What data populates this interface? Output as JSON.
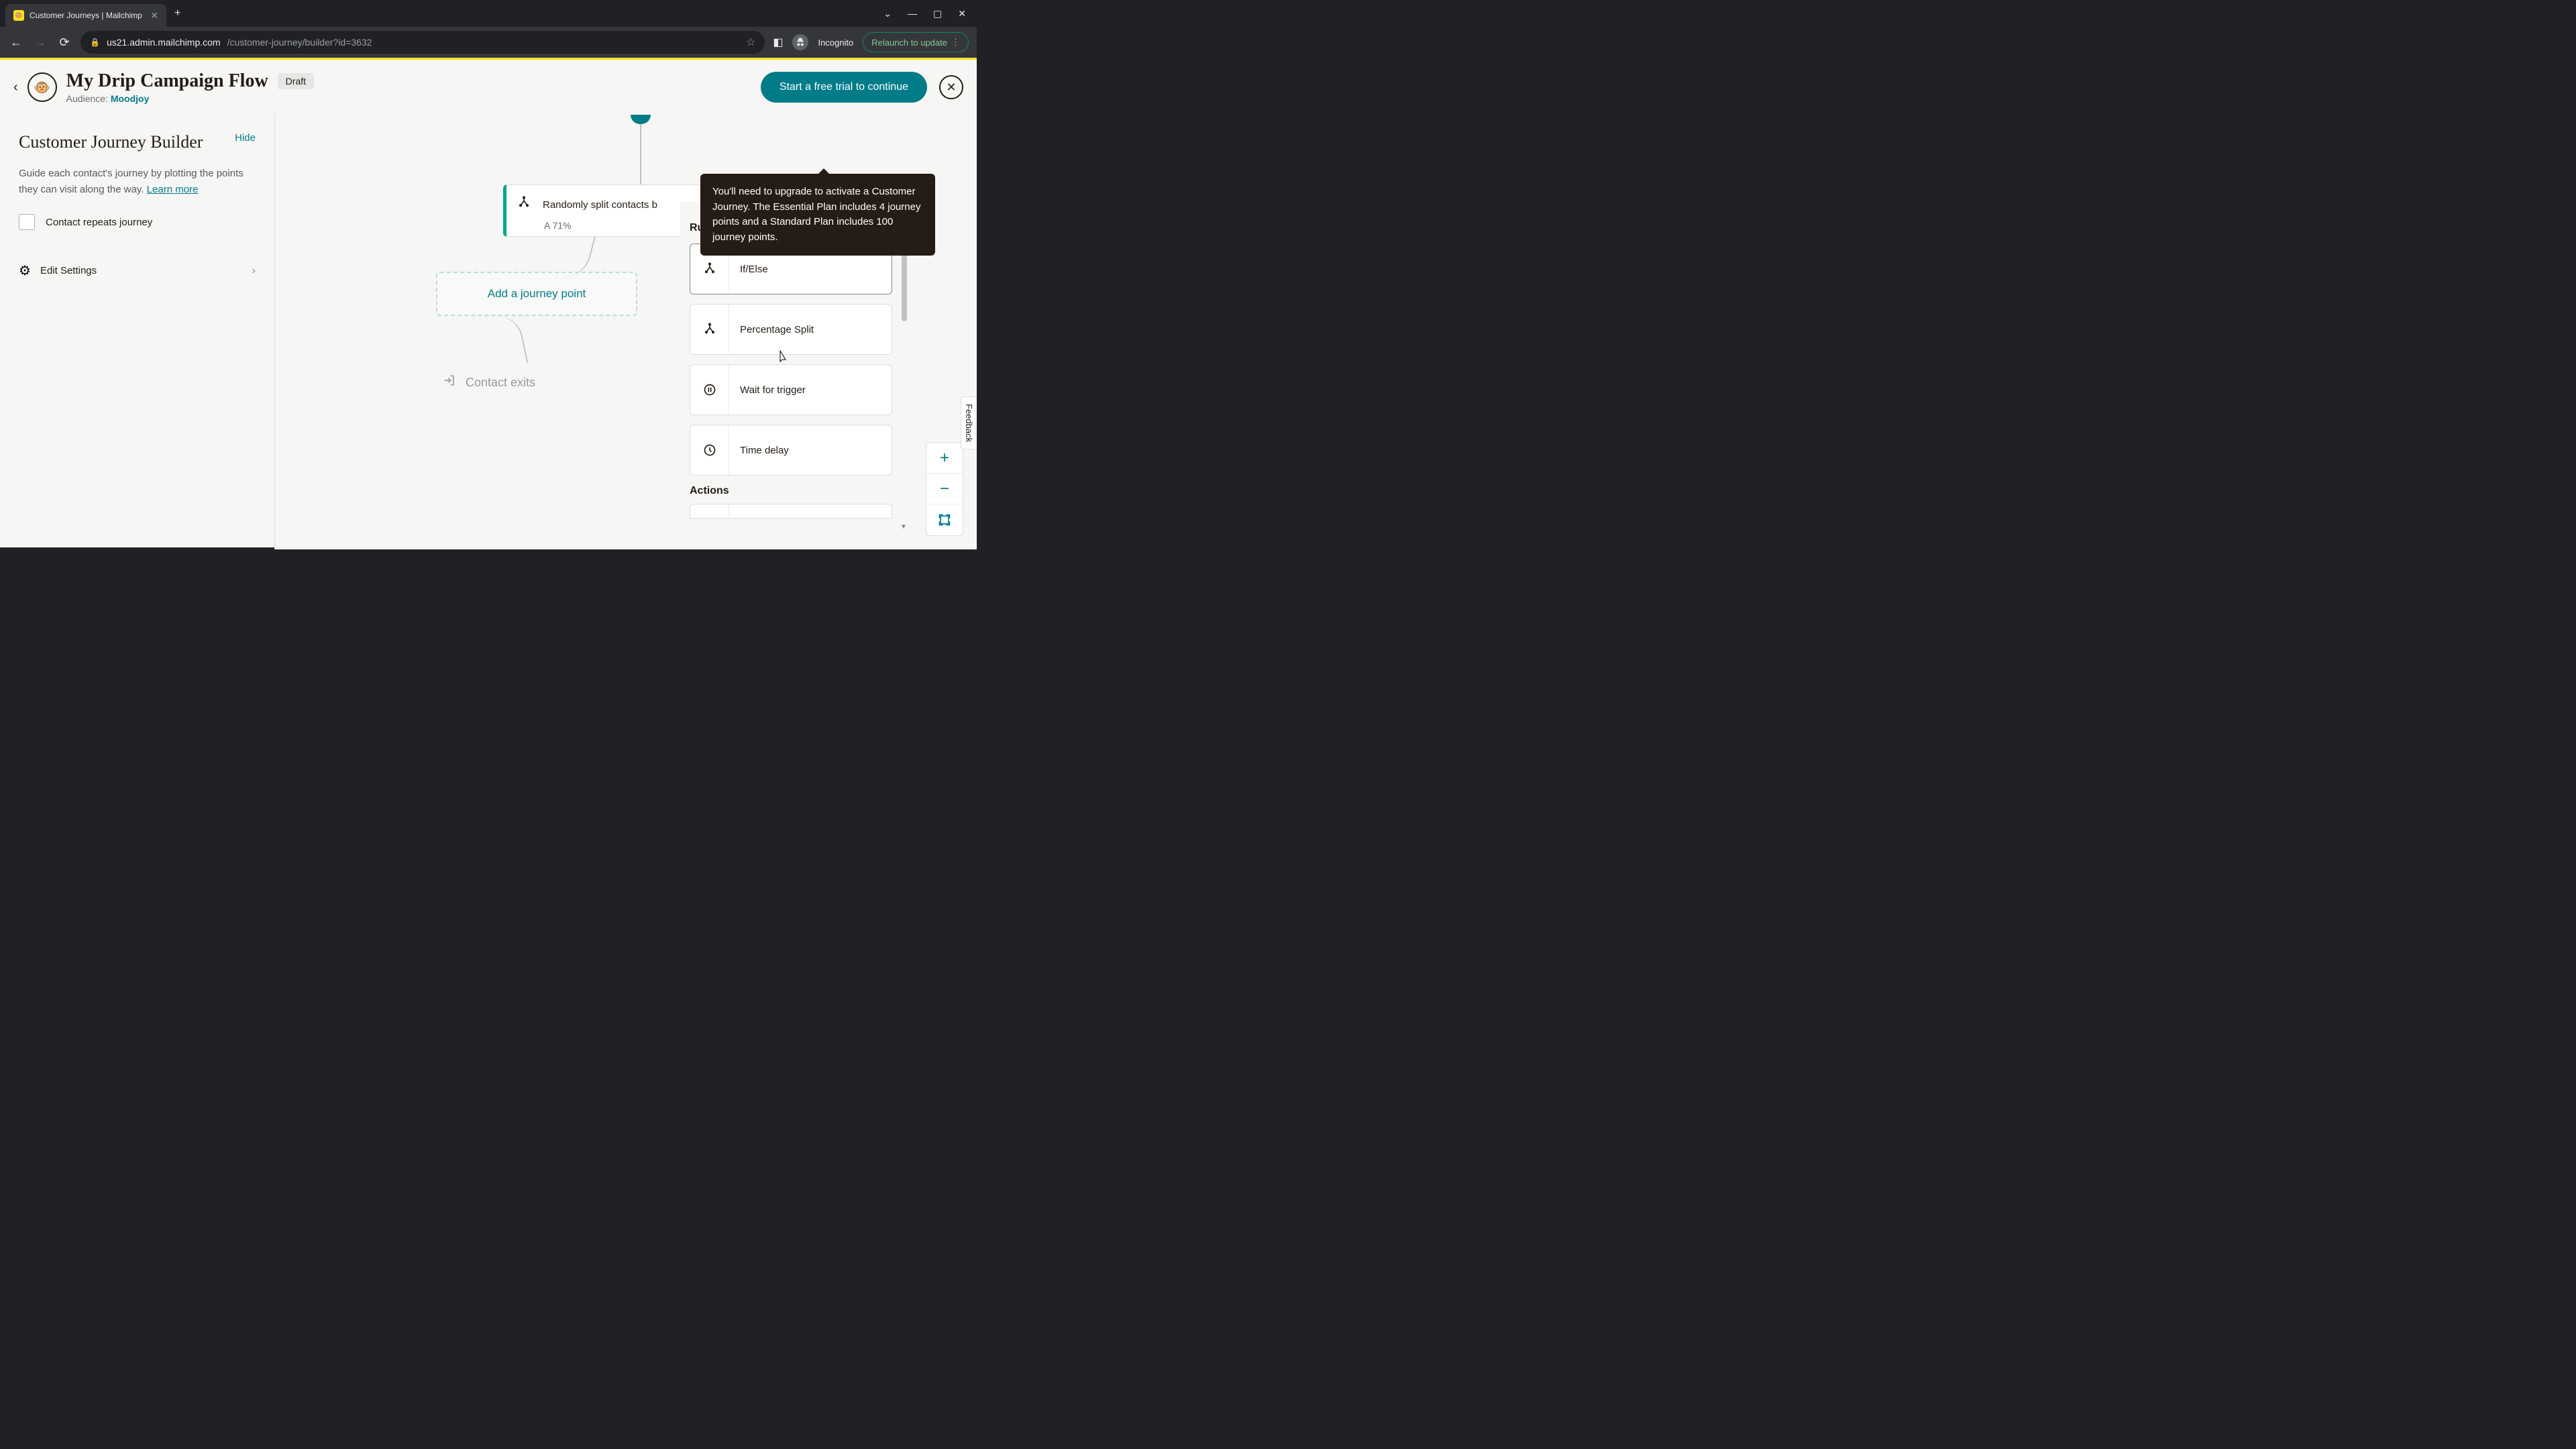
{
  "browser": {
    "tab_title": "Customer Journeys | Mailchimp",
    "url_host": "us21.admin.mailchimp.com",
    "url_path": "/customer-journey/builder?id=3632",
    "incognito": "Incognito",
    "relaunch": "Relaunch to update"
  },
  "header": {
    "title": "My Drip Campaign Flow",
    "status": "Draft",
    "audience_label": "Audience: ",
    "audience_name": "Moodjoy",
    "cta": "Start a free trial to continue"
  },
  "tooltip": {
    "text": "You'll need to upgrade to activate a Customer Journey. The Essential Plan includes 4 journey points and a Standard Plan includes 100 journey points."
  },
  "sidebar": {
    "title": "Customer Journey Builder",
    "hide": "Hide",
    "desc": "Guide each contact's journey by plotting the points they can visit along the way. ",
    "learn_more": "Learn more",
    "checkbox_label": "Contact repeats journey",
    "settings": "Edit Settings"
  },
  "canvas": {
    "split_text": "Randomly split contacts b",
    "split_ratio": "A 71%",
    "add_point": "Add a journey point",
    "exit": "Contact exits"
  },
  "rules_panel": {
    "rules_title": "Rules",
    "actions_title": "Actions",
    "items": {
      "if_else": "If/Else",
      "percentage_split": "Percentage Split",
      "wait_trigger": "Wait for trigger",
      "time_delay": "Time delay"
    }
  },
  "feedback": "Feedback"
}
